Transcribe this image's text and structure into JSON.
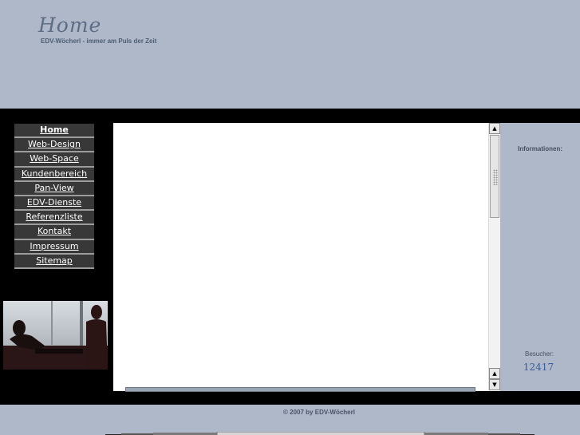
{
  "header": {
    "title": "Home",
    "tagline": "EDV-Wöcherl  - immer am Puls der Zeit"
  },
  "nav": {
    "items": [
      {
        "label": "Home",
        "active": true
      },
      {
        "label": "Web-Design"
      },
      {
        "label": "Web-Space"
      },
      {
        "label": "Kundenbereich"
      },
      {
        "label": "Pan-View"
      },
      {
        "label": "EDV-Dienste"
      },
      {
        "label": "Referenzliste"
      },
      {
        "label": "Kontakt"
      },
      {
        "label": "Impressum"
      },
      {
        "label": "Sitemap"
      }
    ]
  },
  "sidebar_right": {
    "info_label": "Informationen:",
    "visitor_label": "Besucher:",
    "visitor_count": "12417"
  },
  "footer": {
    "copyright": "© 2007 by EDV-Wöcherl"
  },
  "colors": {
    "background": "#aeb8c8",
    "band": "#000000",
    "nav_button": "#383838"
  }
}
